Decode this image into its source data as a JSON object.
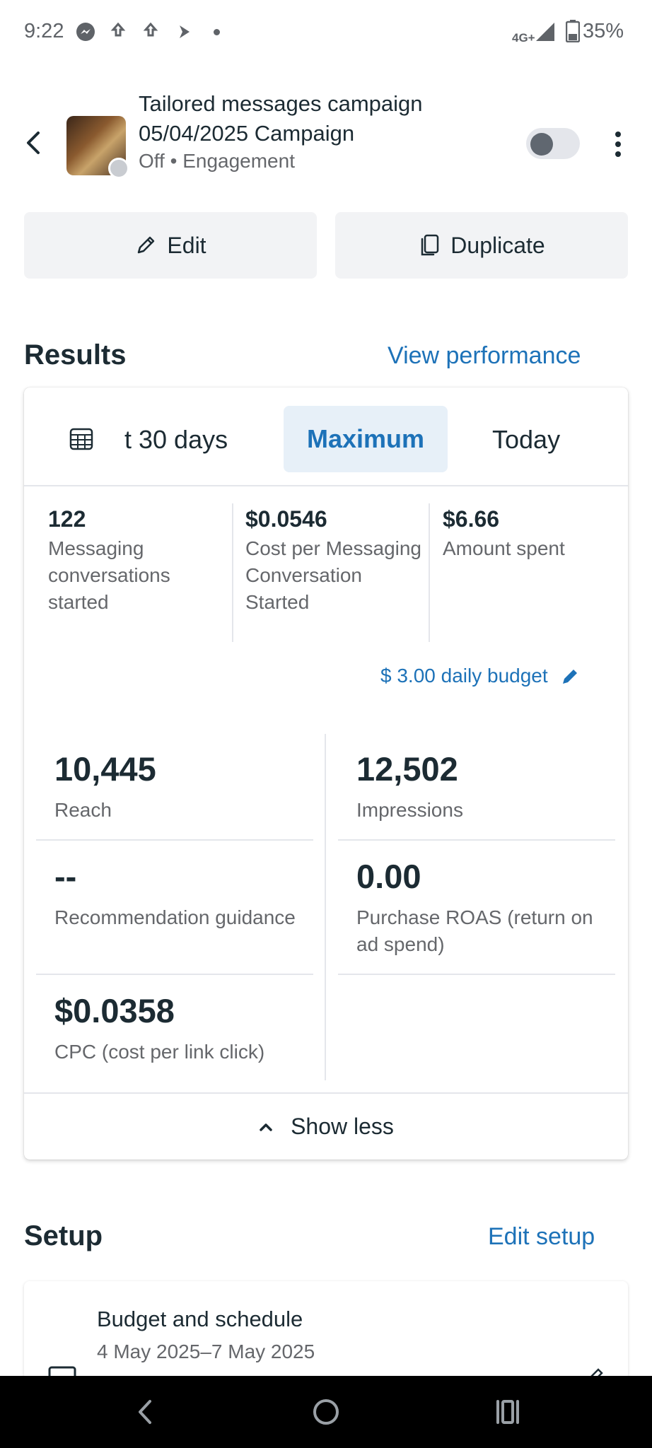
{
  "status_bar": {
    "time": "9:22",
    "network": "4G+",
    "battery": "35%"
  },
  "header": {
    "title_line1": "Tailored messages campaign",
    "title_line2": "05/04/2025 Campaign",
    "subtitle": "Off • Engagement",
    "toggle_on": false
  },
  "actions": {
    "edit_label": "Edit",
    "duplicate_label": "Duplicate"
  },
  "results": {
    "title": "Results",
    "view_performance": "View performance",
    "ranges": {
      "partial": "t 30 days",
      "selected": "Maximum",
      "today": "Today"
    },
    "top_metrics": [
      {
        "value": "122",
        "label": "Messaging conversations started"
      },
      {
        "value": "$0.0546",
        "label": "Cost per Messaging Conversation Started"
      },
      {
        "value": "$6.66",
        "label": "Amount spent"
      }
    ],
    "budget": "$ 3.00 daily budget",
    "metrics": {
      "reach": {
        "value": "10,445",
        "label": "Reach"
      },
      "impressions": {
        "value": "12,502",
        "label": "Impressions"
      },
      "recommendation": {
        "value": "--",
        "label": "Recommendation guidance"
      },
      "roas": {
        "value": "0.00",
        "label": "Purchase ROAS (return on ad spend)"
      },
      "cpc": {
        "value": "$0.0358",
        "label": "CPC (cost per link click)"
      }
    },
    "show_less": "Show less"
  },
  "setup": {
    "title": "Setup",
    "edit_setup": "Edit setup",
    "budget_schedule_title": "Budget and schedule",
    "budget_schedule_dates": "4 May 2025–7 May 2025"
  }
}
